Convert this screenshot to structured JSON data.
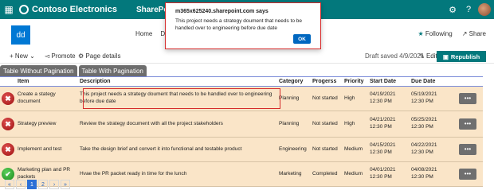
{
  "suite": {
    "brand": "Contoso Electronics",
    "app": "SharePoint"
  },
  "site": {
    "logo_text": "dd",
    "nav": [
      "Home",
      "Do"
    ],
    "following": "Following",
    "share": "Share"
  },
  "commands": {
    "new": "New",
    "promote": "Promote",
    "page_details": "Page details",
    "saved": "Draft saved 4/9/2021",
    "edit": "Edit",
    "republish": "Republish"
  },
  "tabs": [
    "Table Without Pagination",
    "Table With Pagination"
  ],
  "table": {
    "headers": [
      "Item",
      "Description",
      "Category",
      "Progerss",
      "Priority",
      "Start Date",
      "Due Date"
    ],
    "rows": [
      {
        "status": "red",
        "item": "Create a stategy document",
        "description": "This project needs a strategy doument that needs to be handled over to engineering before due date",
        "category": "Planning",
        "progress": "Not started",
        "priority": "High",
        "start_date": "04/19/2021",
        "start_time": "12:30 PM",
        "due_date": "05/19/2021",
        "due_time": "12:30 PM"
      },
      {
        "status": "red",
        "item": "Strategy preview",
        "description": "Review the strategy document with all the project stakeholders",
        "category": "Planning",
        "progress": "Not started",
        "priority": "High",
        "start_date": "04/21/2021",
        "start_time": "12:30 PM",
        "due_date": "05/25/2021",
        "due_time": "12:30 PM"
      },
      {
        "status": "red",
        "item": "Implement and test",
        "description": "Take the design brief and convert it into functional and testable product",
        "category": "Engineering",
        "progress": "Not started",
        "priority": "Medium",
        "start_date": "04/15/2021",
        "start_time": "12:30 PM",
        "due_date": "04/22/2021",
        "due_time": "12:30 PM"
      },
      {
        "status": "green",
        "item": "Marketing plan and PR packets",
        "description": "Hvae the PR packet ready in time for the lunch",
        "category": "Marketing",
        "progress": "Completed",
        "priority": "Medium",
        "start_date": "04/01/2021",
        "start_time": "12:30 PM",
        "due_date": "04/08/2021",
        "due_time": "12:30 PM"
      }
    ],
    "more_label": "•••"
  },
  "pager": [
    "«",
    "‹",
    "1",
    "2",
    "›",
    "»"
  ],
  "pager_active": "1",
  "dialog": {
    "title": "m365x625240.sharepoint.com says",
    "message": "This project needs a strategy doument that needs to be handled over to engineering before due date",
    "ok": "OK"
  },
  "colors": {
    "suite_bar": "#03787c",
    "row_bg": "#fae5c8",
    "highlight": "#d52b2b",
    "ok_button": "#0067c0"
  }
}
